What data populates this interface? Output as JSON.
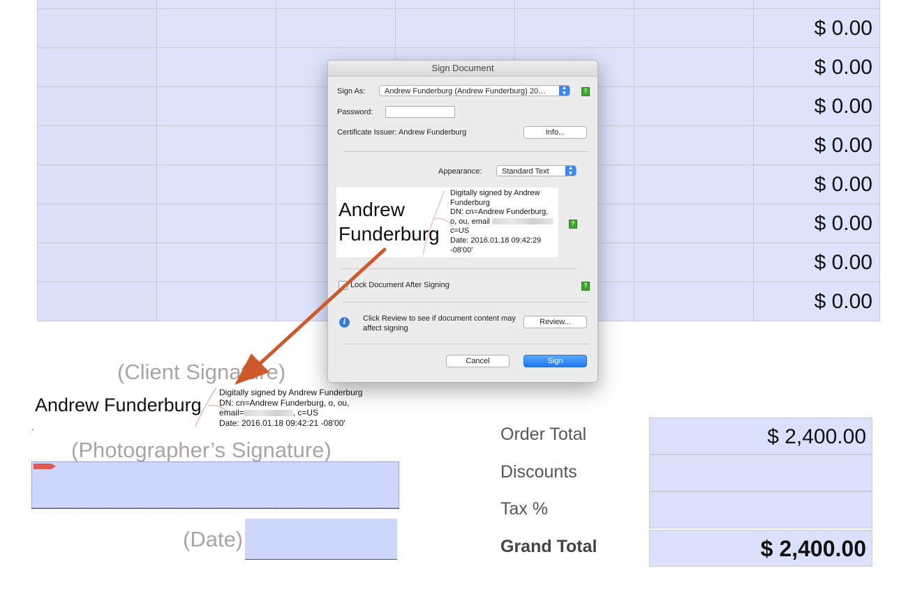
{
  "grid": {
    "amounts": [
      "$ 0.00",
      "$ 0.00",
      "$ 0.00",
      "$ 0.00",
      "$ 0.00",
      "$ 0.00",
      "$ 0.00",
      "$ 0.00"
    ]
  },
  "form": {
    "client_signature_label": "(Client Signature)",
    "photographer_signature_label": "(Photographer’s Signature)",
    "date_label": "(Date)"
  },
  "placed_signature": {
    "name": "Andrew Funderburg",
    "line1": "Digitally signed by Andrew Funderburg",
    "line2": "DN: cn=Andrew Funderburg, o, ou,",
    "line3_prefix": "email=",
    "line3_suffix": ", c=US",
    "line4": "Date: 2016.01.18 09:42:21 -08'00'"
  },
  "totals": {
    "order_total_label": "Order Total",
    "order_total_value": "$ 2,400.00",
    "discounts_label": "Discounts",
    "tax_label": "Tax %",
    "grand_total_label": "Grand Total",
    "grand_total_value": "$ 2,400.00"
  },
  "dialog": {
    "title": "Sign Document",
    "sign_as_label": "Sign As:",
    "sign_as_value": "Andrew Funderburg (Andrew Funderburg) 20…",
    "password_label": "Password:",
    "password_value": "",
    "issuer_text": "Certificate Issuer: Andrew Funderburg",
    "info_button": "Info...",
    "appearance_label": "Appearance:",
    "appearance_value": "Standard Text",
    "preview_name_line1": "Andrew",
    "preview_name_line2": "Funderburg",
    "preview_info_1": "Digitally signed by Andrew",
    "preview_info_2": "Funderburg",
    "preview_info_3": "DN: cn=Andrew Funderburg,",
    "preview_info_4": "o, ou, email",
    "preview_info_5": "c=US",
    "preview_info_6": "Date: 2016.01.18 09:42:29",
    "preview_info_7": "-08'00'",
    "lock_label": "Lock Document After Signing",
    "lock_checked": false,
    "review_text": "Click Review to see if document content may affect signing",
    "review_button": "Review...",
    "cancel_button": "Cancel",
    "sign_button": "Sign",
    "help_glyph": "?"
  },
  "colors": {
    "field_fill": "#dde3fb",
    "arrow": "#cc5a2c",
    "primary_button": "#1d77f0",
    "label_gray": "#aca3a3"
  },
  "icons": [
    "help-icon",
    "info-icon",
    "chevron-updown-icon",
    "annotation-arrow"
  ]
}
